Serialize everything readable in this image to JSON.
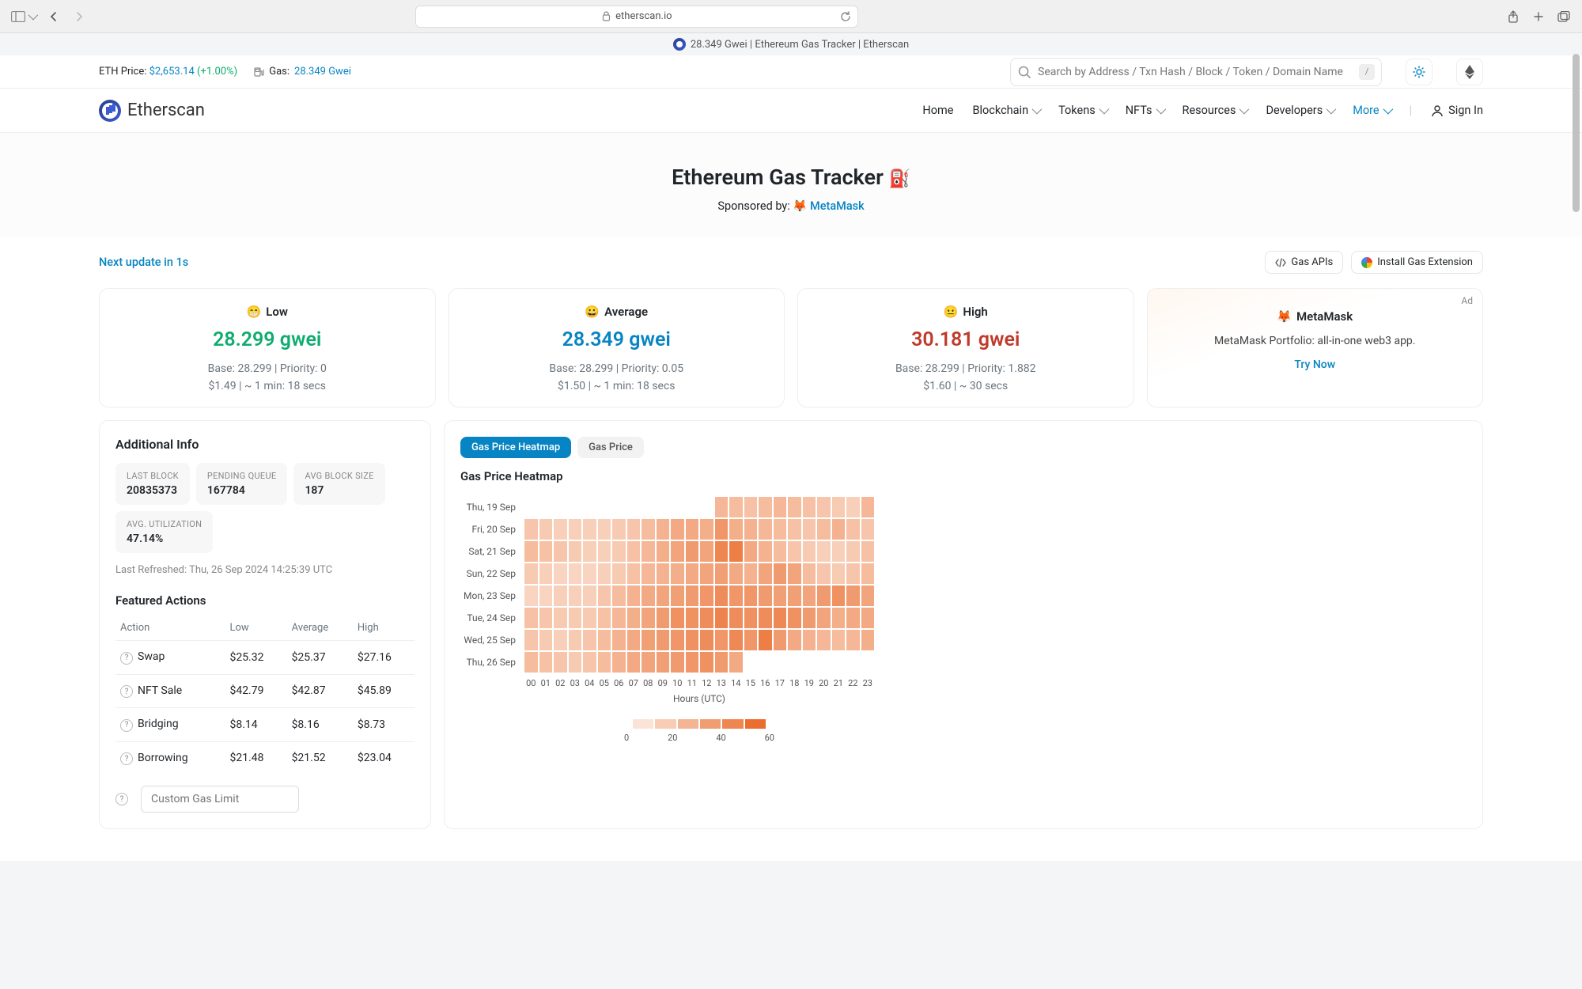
{
  "browser": {
    "url": "etherscan.io",
    "tab_title": "28.349 Gwei | Ethereum Gas Tracker | Etherscan"
  },
  "topbar": {
    "eth_price_label": "ETH Price: ",
    "eth_price_value": "$2,653.14",
    "eth_price_change": " (+1.00%)",
    "gas_label": "Gas: ",
    "gas_value": "28.349 Gwei",
    "search_placeholder": "Search by Address / Txn Hash / Block / Token / Domain Name",
    "search_shortcut": "/"
  },
  "nav": {
    "brand": "Etherscan",
    "items": [
      "Home",
      "Blockchain",
      "Tokens",
      "NFTs",
      "Resources",
      "Developers",
      "More"
    ],
    "signin": "Sign In"
  },
  "header": {
    "title": "Ethereum Gas Tracker ",
    "pump_icon": "⛽",
    "sponsored_prefix": "Sponsored by: ",
    "sponsor_emoji": "🦊 ",
    "sponsor": "MetaMask"
  },
  "meta": {
    "update_prefix": "Next update in ",
    "update_value": "1s",
    "gas_apis": "Gas APIs",
    "install_ext": "Install Gas Extension"
  },
  "gas_cards": {
    "low": {
      "emoji": "😁",
      "label": "Low",
      "value": "28.299 gwei",
      "line1": "Base: 28.299 | Priority: 0",
      "line2": "$1.49 | ~ 1 min: 18 secs"
    },
    "avg": {
      "emoji": "😀",
      "label": "Average",
      "value": "28.349 gwei",
      "line1": "Base: 28.299 | Priority: 0.05",
      "line2": "$1.50 | ~ 1 min: 18 secs"
    },
    "high": {
      "emoji": "😐",
      "label": "High",
      "value": "30.181 gwei",
      "line1": "Base: 28.299 | Priority: 1.882",
      "line2": "$1.60 | ~ 30 secs"
    }
  },
  "ad": {
    "tag": "Ad",
    "emoji": "🦊 ",
    "brand": "MetaMask",
    "desc": "MetaMask Portfolio: all-in-one web3 app.",
    "cta": "Try Now"
  },
  "info": {
    "title": "Additional Info",
    "boxes": [
      {
        "label": "LAST BLOCK",
        "value": "20835373"
      },
      {
        "label": "PENDING QUEUE",
        "value": "167784"
      },
      {
        "label": "AVG BLOCK SIZE",
        "value": "187"
      },
      {
        "label": "AVG. UTILIZATION",
        "value": "47.14%"
      }
    ],
    "refreshed": "Last Refreshed: Thu, 26 Sep 2024 14:25:39 UTC",
    "featured_title": "Featured Actions",
    "columns": [
      "Action",
      "Low",
      "Average",
      "High"
    ],
    "rows": [
      {
        "action": "Swap",
        "low": "$25.32",
        "avg": "$25.37",
        "high": "$27.16"
      },
      {
        "action": "NFT Sale",
        "low": "$42.79",
        "avg": "$42.87",
        "high": "$45.89"
      },
      {
        "action": "Bridging",
        "low": "$8.14",
        "avg": "$8.16",
        "high": "$8.73"
      },
      {
        "action": "Borrowing",
        "low": "$21.48",
        "avg": "$21.52",
        "high": "$23.04"
      }
    ],
    "custom_gas_placeholder": "Custom Gas Limit"
  },
  "heatmap": {
    "tab_active": "Gas Price Heatmap",
    "tab_inactive": "Gas Price",
    "title": "Gas Price Heatmap",
    "days": [
      "Thu, 19 Sep",
      "Fri, 20 Sep",
      "Sat, 21 Sep",
      "Sun, 22 Sep",
      "Mon, 23 Sep",
      "Tue, 24 Sep",
      "Wed, 25 Sep",
      "Thu, 26 Sep"
    ],
    "hours": [
      "00",
      "01",
      "02",
      "03",
      "04",
      "05",
      "06",
      "07",
      "08",
      "09",
      "10",
      "11",
      "12",
      "13",
      "14",
      "15",
      "16",
      "17",
      "18",
      "19",
      "20",
      "21",
      "22",
      "23"
    ],
    "axis": "Hours (UTC)",
    "legend_ticks": [
      "0",
      "20",
      "40",
      "60"
    ]
  },
  "chart_data": {
    "type": "heatmap",
    "title": "Gas Price Heatmap",
    "xlabel": "Hours (UTC)",
    "ylabel": "",
    "x": [
      "00",
      "01",
      "02",
      "03",
      "04",
      "05",
      "06",
      "07",
      "08",
      "09",
      "10",
      "11",
      "12",
      "13",
      "14",
      "15",
      "16",
      "17",
      "18",
      "19",
      "20",
      "21",
      "22",
      "23"
    ],
    "y": [
      "Thu, 19 Sep",
      "Fri, 20 Sep",
      "Sat, 21 Sep",
      "Sun, 22 Sep",
      "Mon, 23 Sep",
      "Tue, 24 Sep",
      "Wed, 25 Sep",
      "Thu, 26 Sep"
    ],
    "z": [
      [
        null,
        null,
        null,
        null,
        null,
        null,
        null,
        null,
        null,
        null,
        null,
        null,
        null,
        24,
        22,
        20,
        22,
        24,
        22,
        20,
        18,
        16,
        14,
        24
      ],
      [
        18,
        16,
        14,
        14,
        14,
        14,
        16,
        18,
        22,
        26,
        30,
        30,
        28,
        38,
        28,
        26,
        24,
        22,
        20,
        18,
        22,
        26,
        20,
        18
      ],
      [
        22,
        20,
        18,
        16,
        14,
        14,
        16,
        20,
        24,
        28,
        32,
        36,
        32,
        45,
        48,
        30,
        26,
        22,
        18,
        16,
        14,
        14,
        16,
        20
      ],
      [
        16,
        14,
        12,
        12,
        12,
        14,
        16,
        20,
        24,
        26,
        28,
        30,
        32,
        34,
        30,
        26,
        32,
        36,
        32,
        22,
        18,
        16,
        18,
        22
      ],
      [
        12,
        12,
        14,
        14,
        14,
        18,
        22,
        26,
        30,
        32,
        34,
        36,
        38,
        42,
        38,
        38,
        36,
        34,
        34,
        32,
        36,
        40,
        36,
        32
      ],
      [
        20,
        18,
        16,
        16,
        16,
        20,
        24,
        28,
        32,
        36,
        40,
        40,
        42,
        46,
        42,
        40,
        42,
        44,
        40,
        36,
        32,
        28,
        30,
        30
      ],
      [
        18,
        16,
        14,
        16,
        18,
        22,
        26,
        30,
        34,
        36,
        38,
        40,
        42,
        38,
        44,
        38,
        48,
        36,
        30,
        26,
        24,
        22,
        24,
        28
      ],
      [
        22,
        20,
        18,
        16,
        18,
        22,
        26,
        30,
        32,
        34,
        36,
        38,
        40,
        36,
        30,
        null,
        null,
        null,
        null,
        null,
        null,
        null,
        null,
        null
      ]
    ],
    "colorscale": [
      [
        0,
        "#fdf0e8"
      ],
      [
        0.33,
        "#f9c4a5"
      ],
      [
        0.56,
        "#f29862"
      ],
      [
        1,
        "#e8621e"
      ]
    ],
    "zmin": 0,
    "zmax": 60,
    "legend_ticks": [
      0,
      20,
      40,
      60
    ]
  }
}
